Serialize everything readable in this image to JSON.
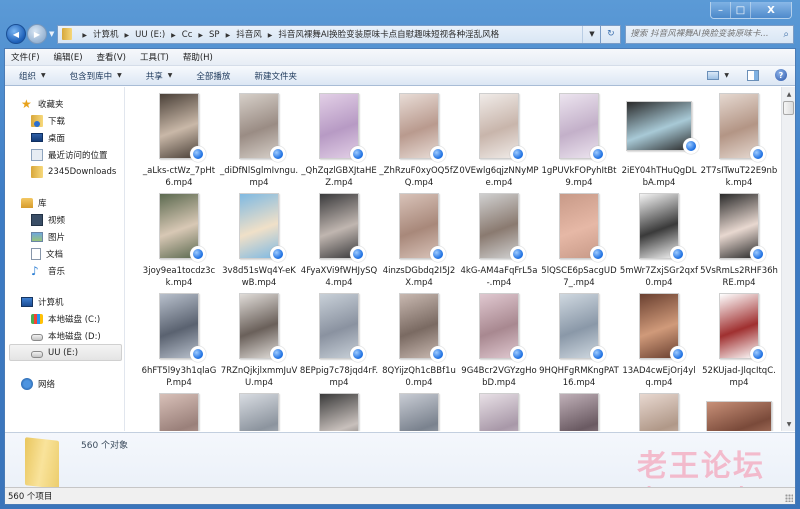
{
  "window": {
    "controls": {
      "minimize": "–",
      "maximize": "□",
      "close": "X"
    }
  },
  "nav": {
    "back_icon": "◀",
    "forward_icon": "▶",
    "dropdown_icon": "▼",
    "breadcrumb": [
      "计算机",
      "UU (E:)",
      "Cc",
      "SP",
      "抖音风",
      "抖音风裸舞AI换脸变装原味卡点自慰趣味短视各种淫乱风格"
    ],
    "separator": "▶",
    "refresh_icon": "↻",
    "search_placeholder": "搜索 抖音风裸舞AI换脸变装原味卡...",
    "search_icon": "⌕"
  },
  "menubar": [
    "文件(F)",
    "编辑(E)",
    "查看(V)",
    "工具(T)",
    "帮助(H)"
  ],
  "cmdbar": {
    "items": [
      {
        "label": "组织",
        "has_dropdown": true
      },
      {
        "label": "包含到库中",
        "has_dropdown": true
      },
      {
        "label": "共享",
        "has_dropdown": true
      },
      {
        "label": "全部播放",
        "has_dropdown": false
      },
      {
        "label": "新建文件夹",
        "has_dropdown": false
      }
    ],
    "dropdown_arrow": "▼",
    "help_icon": "?"
  },
  "sidebar": {
    "favorites": {
      "label": "收藏夹",
      "items": [
        "下载",
        "桌面",
        "最近访问的位置",
        "2345Downloads"
      ]
    },
    "libraries": {
      "label": "库",
      "items": [
        "视频",
        "图片",
        "文档",
        "音乐"
      ]
    },
    "computer": {
      "label": "计算机",
      "items": [
        "本地磁盘 (C:)",
        "本地磁盘 (D:)",
        "UU (E:)"
      ],
      "selected": "UU (E:)"
    },
    "network": {
      "label": "网络"
    }
  },
  "files": [
    {
      "name": "_aLks-ctWz_7pHt6.mp4",
      "thumb": [
        "#4a4038",
        "#c9b8a8"
      ]
    },
    {
      "name": "_diDfNlSglmIvngu.mp4",
      "thumb": [
        "#d6cfc8",
        "#9a8c84"
      ]
    },
    {
      "name": "_QhZqzlGBXJtaHEZ.mp4",
      "thumb": [
        "#e2cfe6",
        "#b79ac4"
      ]
    },
    {
      "name": "_ZhRzuF0xyOQ5fZQ.mp4",
      "thumb": [
        "#e8dcd6",
        "#b99a8e"
      ]
    },
    {
      "name": "0VEwlg6qjzNNyMPe.mp4",
      "thumb": [
        "#f0ebe8",
        "#c8b5ab"
      ]
    },
    {
      "name": "1gPUVkFOPyhItBt9.mp4",
      "thumb": [
        "#ece4ef",
        "#c3b0c9"
      ]
    },
    {
      "name": "2iEY04hTHuQgDLbA.mp4",
      "thumb": [
        "#2a2a2a",
        "#a8c9d6"
      ],
      "wide": true
    },
    {
      "name": "2T7sITwuT22E9nbk.mp4",
      "thumb": [
        "#e5d8d0",
        "#b39585"
      ]
    },
    {
      "name": "3joy9ea1tocdz3ck.mp4",
      "thumb": [
        "#5c6a50",
        "#d8c8b5"
      ]
    },
    {
      "name": "3v8d51sWq4Y-eKwB.mp4",
      "thumb": [
        "#7fb9e2",
        "#f0e0c8"
      ]
    },
    {
      "name": "4FyaXVi9fWHJySQ4.mp4",
      "thumb": [
        "#3a3a3c",
        "#c0b6b0"
      ]
    },
    {
      "name": "4inzsDGbdq2I5J2X.mp4",
      "thumb": [
        "#d8c2b8",
        "#a8887a"
      ]
    },
    {
      "name": "4kG-AM4aFqFrL5a-.mp4",
      "thumb": [
        "#d0d0d0",
        "#8a7a70"
      ]
    },
    {
      "name": "5lQSCE6pSacgUD7_.mp4",
      "thumb": [
        "#c89a88",
        "#e6b8a6"
      ]
    },
    {
      "name": "5mWr7ZxjSGr2qxf0.mp4",
      "thumb": [
        "#f4f4f4",
        "#3a3a3a"
      ]
    },
    {
      "name": "5VsRmLs2RHF36hRE.mp4",
      "thumb": [
        "#2a2a2a",
        "#e8d8d0"
      ]
    },
    {
      "name": "6hFT5l9y3h1qlaGP.mp4",
      "thumb": [
        "#b8c0cc",
        "#5a6270"
      ]
    },
    {
      "name": "7RZnQjkjlxmmJuVU.mp4",
      "thumb": [
        "#e0dcd8",
        "#6a605a"
      ]
    },
    {
      "name": "8EPpig7c78jqd4rF.mp4",
      "thumb": [
        "#c8d0d8",
        "#8a92a0"
      ]
    },
    {
      "name": "8QYijzQh1cBBf1u0.mp4",
      "thumb": [
        "#c8b8b0",
        "#7a6a62"
      ]
    },
    {
      "name": "9G4Bcr2VGYzgHobD.mp4",
      "thumb": [
        "#e0c8d0",
        "#a88890"
      ]
    },
    {
      "name": "9HQHFgRMKngPAT16.mp4",
      "thumb": [
        "#cfd8e0",
        "#8a98a8"
      ]
    },
    {
      "name": "13AD4cwEjOrj4ylq.mp4",
      "thumb": [
        "#6a4030",
        "#d09a7a"
      ]
    },
    {
      "name": "52KUjad-JlqcItqC.mp4",
      "thumb": [
        "#ffffff",
        "#a03030"
      ]
    },
    {
      "name": "",
      "thumb": [
        "#d8c0b8",
        "#9a807a"
      ]
    },
    {
      "name": "",
      "thumb": [
        "#d8dce2",
        "#8c949e"
      ]
    },
    {
      "name": "",
      "thumb": [
        "#3a3a3a",
        "#c8c0bc"
      ]
    },
    {
      "name": "",
      "thumb": [
        "#c8ccd4",
        "#7a828e"
      ]
    },
    {
      "name": "",
      "thumb": [
        "#e8e0e6",
        "#a898a8"
      ]
    },
    {
      "name": "",
      "thumb": [
        "#c0b0b8",
        "#6a5a62"
      ]
    },
    {
      "name": "",
      "thumb": [
        "#e8d8d0",
        "#b09888"
      ]
    },
    {
      "name": "",
      "thumb": [
        "#c89078",
        "#7a4a3a"
      ],
      "wide": true
    }
  ],
  "details": {
    "count_text": "560 个对象"
  },
  "status": {
    "text": "560 个项目"
  },
  "watermark": {
    "cn": "老王论坛",
    "en": "laowang.vip",
    "color": "#f4a8bd"
  }
}
